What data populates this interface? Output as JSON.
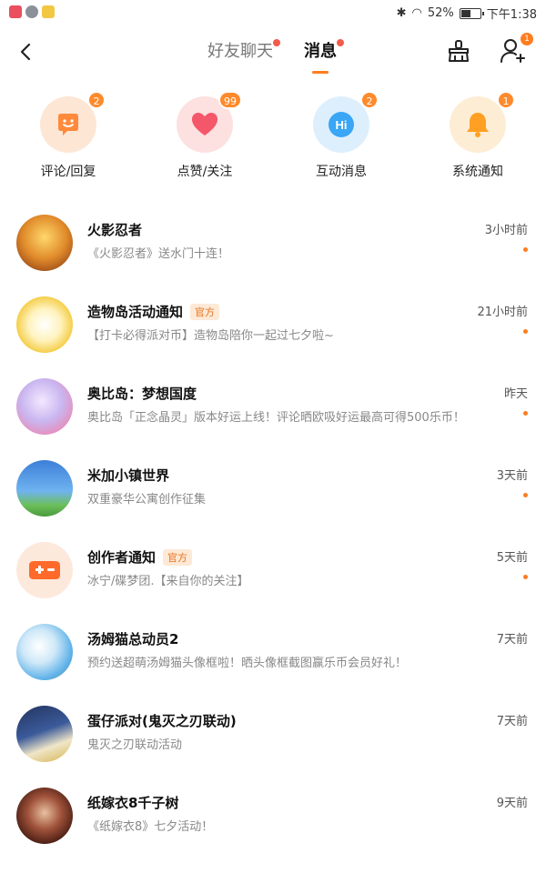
{
  "status_bar": {
    "battery_percent": "52%",
    "battery_level": 0.52,
    "time": "下午1:38"
  },
  "header": {
    "tabs": [
      {
        "label": "好友聊天",
        "active": false,
        "has_dot": true
      },
      {
        "label": "消息",
        "active": true,
        "has_dot": true
      }
    ],
    "add_friend_badge": "1"
  },
  "categories": [
    {
      "label": "评论/回复",
      "badge": "2",
      "icon": "comment-icon",
      "bg": "#fde6d4",
      "fg": "#ff8a3c"
    },
    {
      "label": "点赞/关注",
      "badge": "99",
      "icon": "heart-icon",
      "bg": "#fde0e0",
      "fg": "#f4566a"
    },
    {
      "label": "互动消息",
      "badge": "2",
      "icon": "hi-icon",
      "bg": "#ddeffd",
      "fg": "#3aa6f5"
    },
    {
      "label": "系统通知",
      "badge": "1",
      "icon": "bell-icon",
      "bg": "#fdedd4",
      "fg": "#ffa024"
    }
  ],
  "messages": [
    {
      "title": "火影忍者",
      "official": false,
      "time": "3小时前",
      "preview": "《火影忍者》送水门十连！",
      "unread": true,
      "avatar_color": "#c77a2a"
    },
    {
      "title": "造物岛活动通知",
      "official": true,
      "time": "21小时前",
      "preview": "【打卡必得派对币】造物岛陪你一起过七夕啦~",
      "unread": true,
      "avatar_color": "#f3c93a"
    },
    {
      "title": "奥比岛：梦想国度",
      "official": false,
      "time": "昨天",
      "preview": "奥比岛「正念晶灵」版本好运上线！评论晒欧吸好运最高可得500乐币！",
      "unread": true,
      "avatar_color": "#b9a5e8"
    },
    {
      "title": "米加小镇世界",
      "official": false,
      "time": "3天前",
      "preview": "双重豪华公寓创作征集",
      "unread": true,
      "avatar_color": "#4c8ee0"
    },
    {
      "title": "创作者通知",
      "official": true,
      "time": "5天前",
      "preview": "冰宁/碟梦团.【来自你的关注】",
      "unread": true,
      "avatar_color": "#fde6d4"
    },
    {
      "title": "汤姆猫总动员2",
      "official": false,
      "time": "7天前",
      "preview": "预约送超萌汤姆猫头像框啦！晒头像框截图赢乐币会员好礼！",
      "unread": false,
      "avatar_color": "#5ab0e8"
    },
    {
      "title": "蛋仔派对(鬼灭之刃联动)",
      "official": false,
      "time": "7天前",
      "preview": "鬼灭之刃联动活动",
      "unread": false,
      "avatar_color": "#3b5a9a"
    },
    {
      "title": "纸嫁衣8千子树",
      "official": false,
      "time": "9天前",
      "preview": "《纸嫁衣8》七夕活动！",
      "unread": false,
      "avatar_color": "#7a3b2a"
    }
  ],
  "official_tag": "官方",
  "accent_color": "#ff7d1f"
}
